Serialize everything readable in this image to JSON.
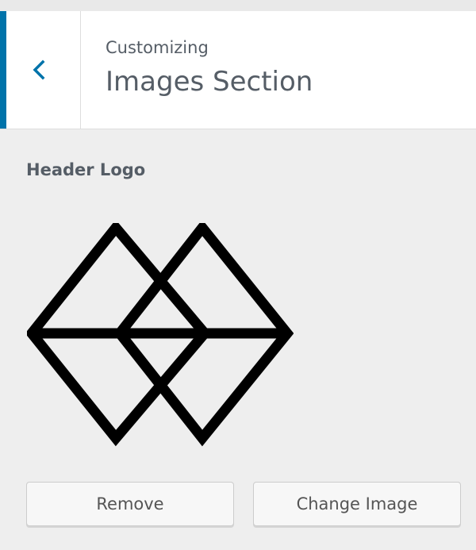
{
  "header": {
    "subtitle": "Customizing",
    "title": "Images Section",
    "back_icon": "chevron-left-icon",
    "accent_color": "#0073aa"
  },
  "control": {
    "label": "Header Logo",
    "image": "diamond-logo"
  },
  "buttons": {
    "remove_label": "Remove",
    "change_label": "Change Image"
  }
}
